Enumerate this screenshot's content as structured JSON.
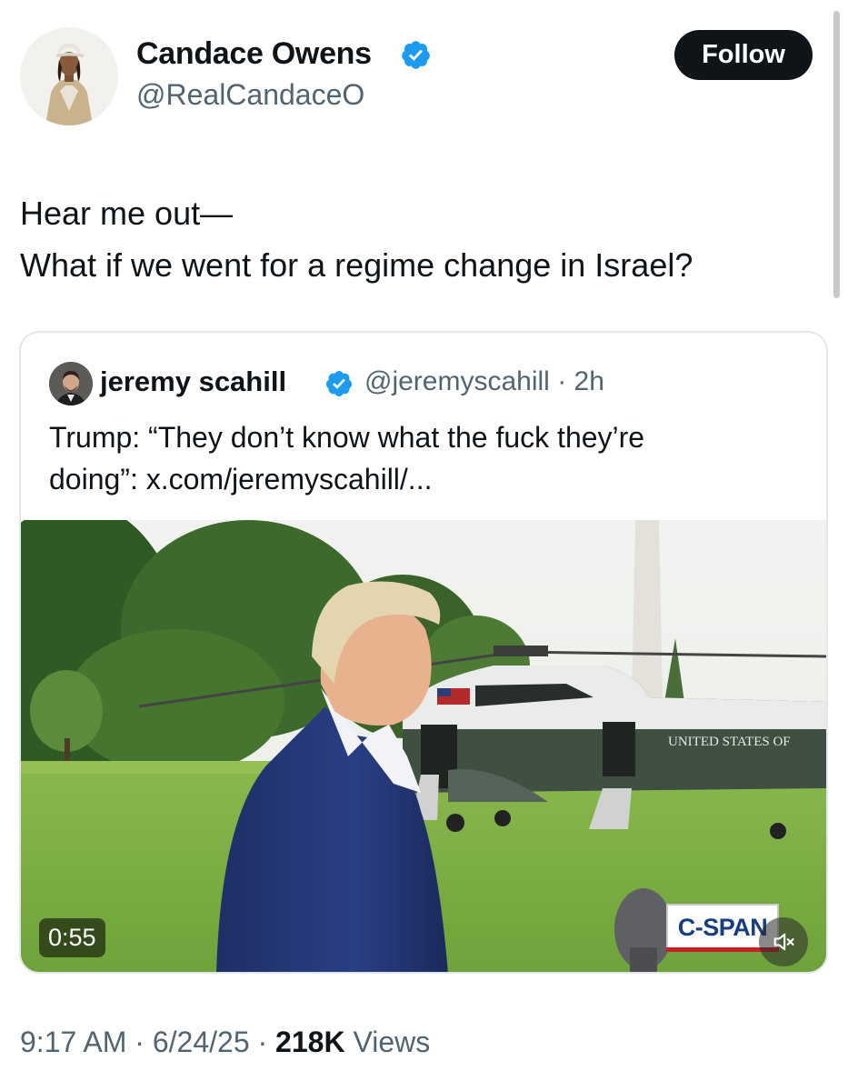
{
  "author": {
    "name": "Candace Owens",
    "handle": "@RealCandaceO",
    "avatar_icon": "profile-photo",
    "verified_icon": "verified-badge-icon",
    "verified_color": "#1d9bf0"
  },
  "follow_button": {
    "label": "Follow"
  },
  "tweet": {
    "lines": [
      "Hear me out—",
      "What if we went for a regime change in Israel?"
    ]
  },
  "quoted_tweet": {
    "author_name": "jeremy scahill",
    "handle": "@jeremyscahill",
    "separator": "·",
    "time": "2h",
    "text_lines": [
      "Trump: “They don’t know what the fuck they’re",
      "doing”: x.com/jeremyscahill/..."
    ],
    "video": {
      "duration": "0:55",
      "broadcaster": "C-SPAN",
      "helicopter_text": "UNITED STATES OF",
      "mute_icon": "muted-speaker-icon"
    }
  },
  "footer": {
    "time": "9:17 AM",
    "date": "6/24/25",
    "separator": "·",
    "views_count": "218K",
    "views_label": "Views"
  },
  "colors": {
    "text": "#0f1419",
    "secondary_text": "#536471",
    "button_bg": "#0f1419",
    "border": "#e3e7ea"
  }
}
